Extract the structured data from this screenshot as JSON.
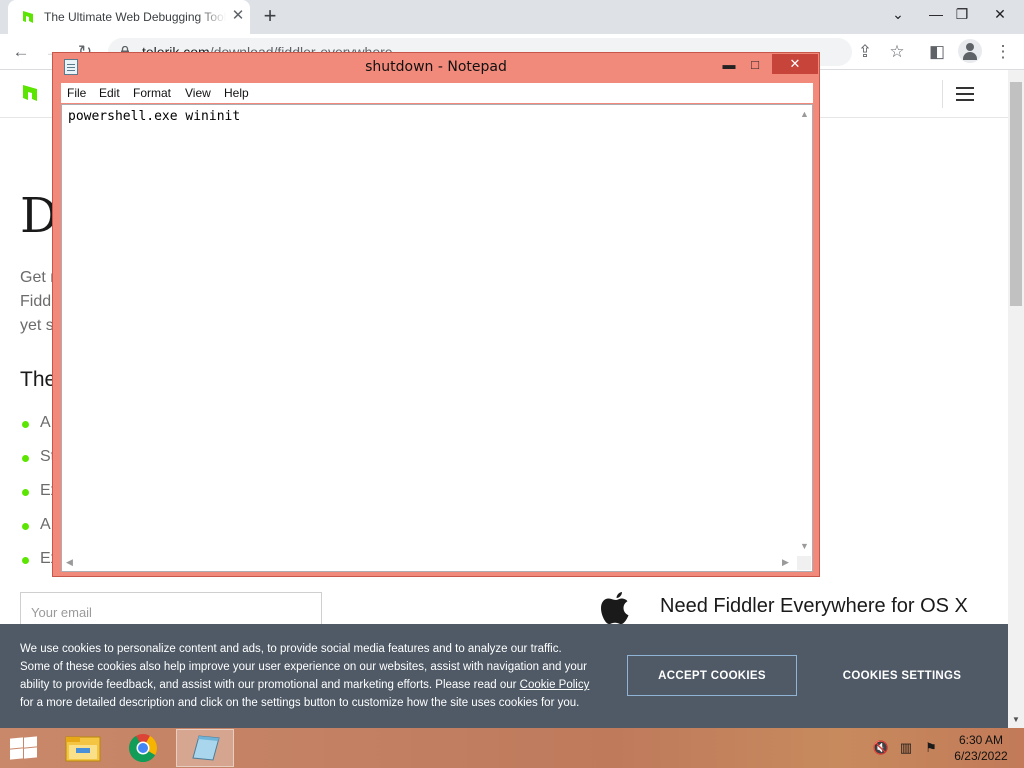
{
  "browser": {
    "tab": {
      "title": "The Ultimate Web Debugging Tool",
      "close_icon": "close-icon"
    },
    "new_tab_label": "+",
    "window_controls": {
      "minimize": "—",
      "restore": "❐",
      "close": "✕",
      "tab_search": "⌄"
    },
    "toolbar": {
      "back": "←",
      "forward": "→",
      "reload": "↻",
      "share": "⇪",
      "bookmark": "☆",
      "sidepanel": "◧",
      "menu": "⋮"
    },
    "url": {
      "host": "telerik.com",
      "path": "/download/fiddler-everywhere"
    }
  },
  "page": {
    "hero_title": "D",
    "hero_desc_lines": [
      "Get n",
      "Fiddl",
      "yet s"
    ],
    "features_title": "The",
    "features": [
      "A",
      "St",
      "Ex",
      "A",
      "Ex"
    ],
    "email_placeholder": "Your email",
    "osx_text": "Need Fiddler Everywhere for OS X",
    "cookie": {
      "text_before": "We use cookies to personalize content and ads, to provide social media features and to analyze our traffic. Some of these cookies also help improve your user experience on our websites, assist with navigation and your ability to provide feedback, and assist with our promotional and marketing efforts. Please read our ",
      "link": "Cookie Policy",
      "text_after": " for a more detailed description and click on the settings button to customize how the site uses cookies for you.",
      "accept": "ACCEPT COOKIES",
      "settings": "COOKIES SETTINGS"
    }
  },
  "notepad": {
    "title": "shutdown - Notepad",
    "menu": [
      "File",
      "Edit",
      "Format",
      "View",
      "Help"
    ],
    "content": "powershell.exe wininit",
    "controls": {
      "minimize": "▬",
      "maximize": "□",
      "close": "✕"
    }
  },
  "taskbar": {
    "apps": [
      "file-explorer-icon",
      "chrome-icon",
      "notepad-icon"
    ],
    "tray": [
      "speaker-muted-icon",
      "network-icon",
      "action-center-icon"
    ],
    "time": "6:30 AM",
    "date": "6/23/2022"
  }
}
